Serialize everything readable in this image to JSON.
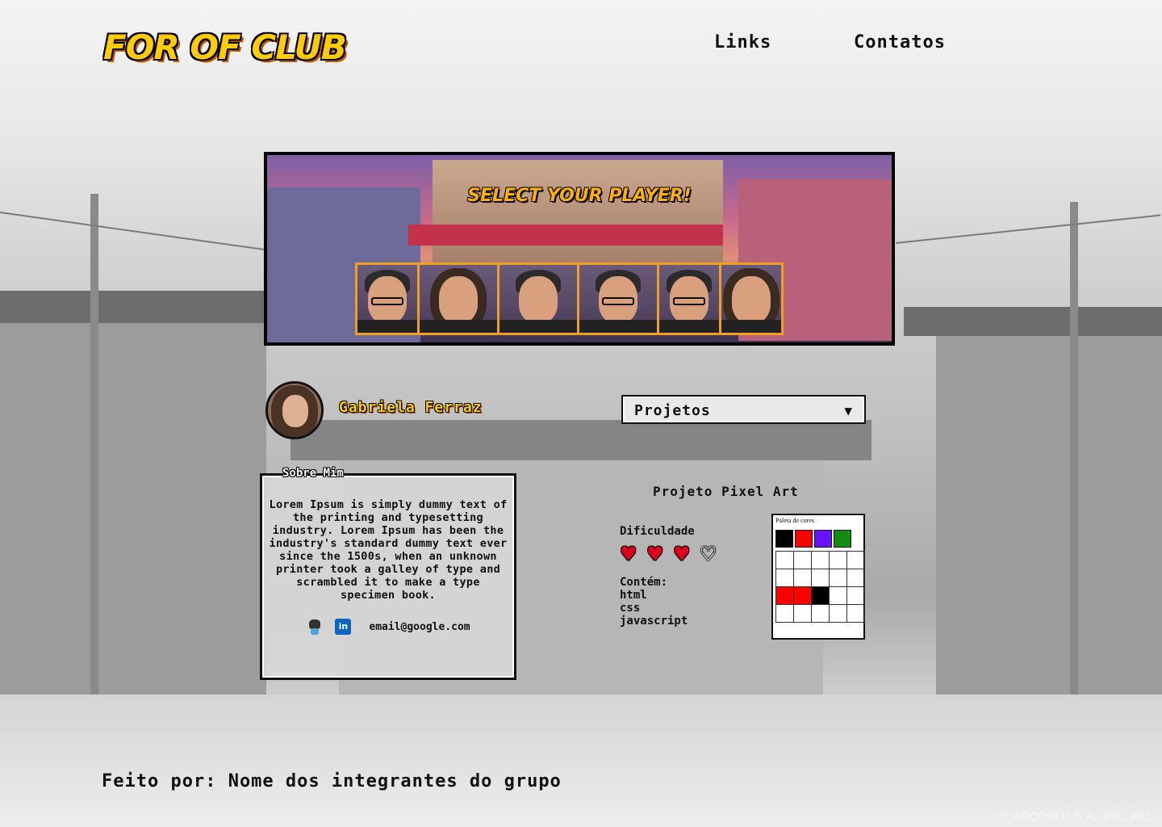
{
  "header": {
    "logo": "FOR OF CLUB",
    "nav": [
      "Links",
      "Contatos"
    ]
  },
  "banner": {
    "title": "SELECT YOUR PLAYER!",
    "players": [
      {
        "name": "player-1",
        "hair": "short",
        "glasses": true
      },
      {
        "name": "player-2",
        "hair": "long",
        "glasses": false
      },
      {
        "name": "player-3",
        "hair": "short",
        "glasses": false
      },
      {
        "name": "player-4",
        "hair": "short",
        "glasses": true
      },
      {
        "name": "player-5",
        "hair": "short",
        "glasses": true
      },
      {
        "name": "player-6",
        "hair": "long",
        "glasses": false
      }
    ]
  },
  "profile": {
    "name": "Gabriela Ferraz",
    "select_value": "Projetos",
    "select_arrow": "▼"
  },
  "about": {
    "title": "Sobre Mim",
    "text": "Lorem Ipsum is simply dummy text of the printing and typesetting industry. Lorem Ipsum has been the industry's standard dummy text ever since the 1500s, when an unknown printer took a galley of type and scrambled it to make a type specimen book.",
    "email": "email@google.com",
    "linkedin_glyph": "in"
  },
  "project": {
    "title": "Projeto Pixel Art",
    "difficulty_label": "Dificuldade",
    "difficulty": {
      "value": 3,
      "max": 4
    },
    "heart_glyph": "♥",
    "heart_empty_glyph": "♡",
    "contains_label": "Contém:",
    "contains": [
      "html",
      "css",
      "javascript"
    ],
    "palette_label": "Paleta de cores",
    "palette_colors": [
      "#000000",
      "#ff0000",
      "#6a11ff",
      "#128c12"
    ],
    "grid": [
      [
        "",
        "",
        "",
        "",
        ""
      ],
      [
        "",
        "",
        "",
        "",
        ""
      ],
      [
        "#ff0000",
        "#ff0000",
        "#000000",
        "",
        ""
      ],
      [
        "",
        "",
        "",
        "",
        ""
      ]
    ]
  },
  "footer": {
    "text": "Feito por: Nome dos integrantes do grupo",
    "copyright": "©CAPCOM U.S.A., INC. ALL"
  }
}
